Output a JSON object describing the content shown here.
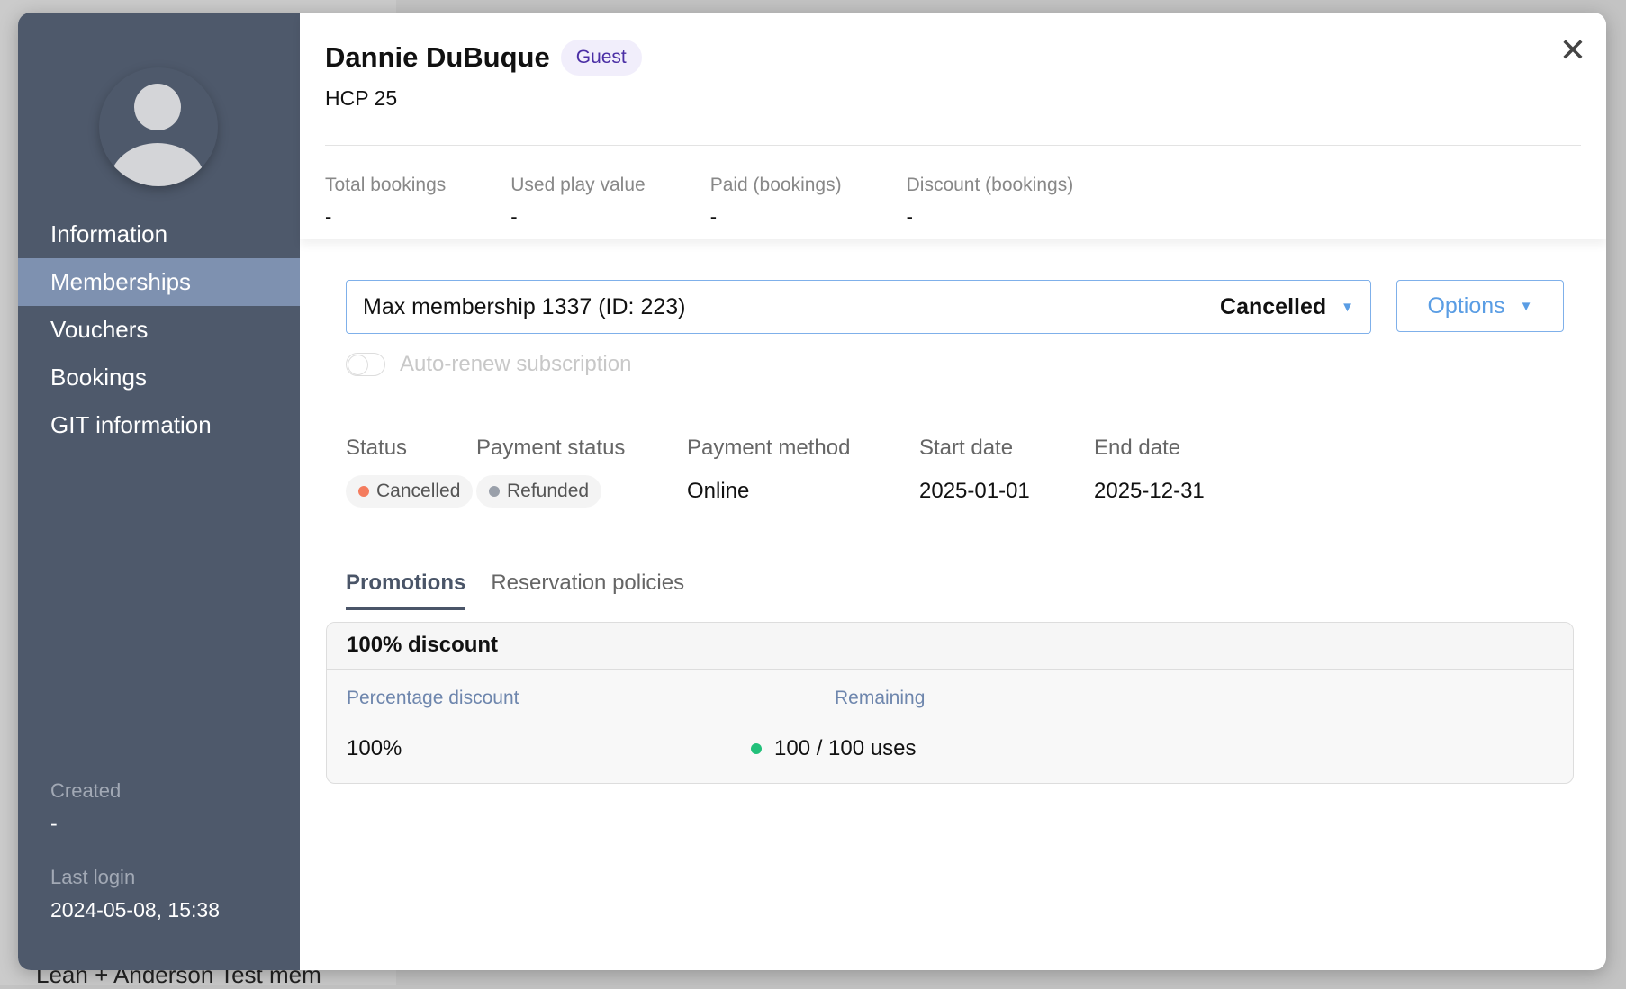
{
  "background": {
    "row_text": "Leah + Anderson Test mem"
  },
  "sidebar": {
    "items": [
      {
        "label": "Information"
      },
      {
        "label": "Memberships",
        "active": true
      },
      {
        "label": "Vouchers"
      },
      {
        "label": "Bookings"
      },
      {
        "label": "GIT information"
      }
    ],
    "created": {
      "label": "Created",
      "value": "-"
    },
    "last_login": {
      "label": "Last login",
      "value": "2024-05-08, 15:38"
    }
  },
  "header": {
    "name": "Dannie DuBuque",
    "badge": "Guest",
    "hcp": "HCP 25"
  },
  "stats": [
    {
      "label": "Total bookings",
      "value": "-"
    },
    {
      "label": "Used play value",
      "value": "-"
    },
    {
      "label": "Paid (bookings)",
      "value": "-"
    },
    {
      "label": "Discount (bookings)",
      "value": "-"
    }
  ],
  "membership": {
    "selected": "Max membership 1337 (ID: 223)",
    "status": "Cancelled",
    "options_label": "Options",
    "auto_renew_label": "Auto-renew subscription",
    "auto_renew": false
  },
  "details": {
    "status": {
      "label": "Status",
      "value": "Cancelled",
      "color": "#f47c5e"
    },
    "payment_status": {
      "label": "Payment status",
      "value": "Refunded",
      "color": "#9aa0aa"
    },
    "payment_method": {
      "label": "Payment method",
      "value": "Online"
    },
    "start_date": {
      "label": "Start date",
      "value": "2025-01-01"
    },
    "end_date": {
      "label": "End date",
      "value": "2025-12-31"
    }
  },
  "tabs": [
    {
      "label": "Promotions",
      "active": true
    },
    {
      "label": "Reservation policies"
    }
  ],
  "promotion": {
    "title": "100% discount",
    "percentage_label": "Percentage discount",
    "percentage_value": "100%",
    "remaining_label": "Remaining",
    "remaining_value": "100 / 100 uses",
    "remaining_color": "#22c07a"
  },
  "colors": {
    "sidebar": "#4e596b",
    "active_item": "#7e91b0",
    "accent": "#5a9de4"
  }
}
